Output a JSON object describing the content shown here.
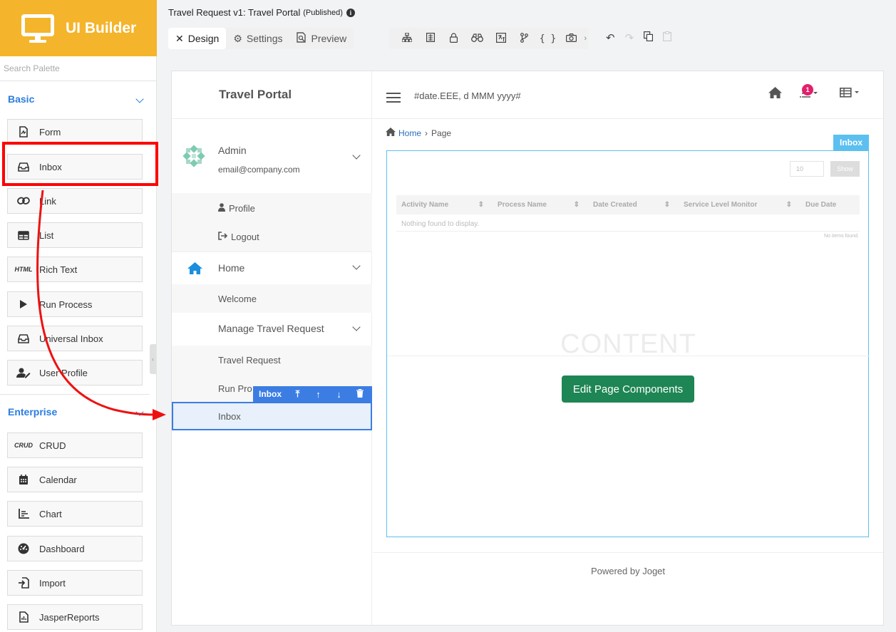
{
  "app": {
    "title": "UI Builder"
  },
  "palette": {
    "search_placeholder": "Search Palette",
    "sections": [
      {
        "title": "Basic",
        "items": [
          {
            "label": "Form",
            "icon": "form-icon"
          },
          {
            "label": "Inbox",
            "icon": "inbox-icon"
          },
          {
            "label": "Link",
            "icon": "link-icon"
          },
          {
            "label": "List",
            "icon": "list-icon"
          },
          {
            "label": "Rich Text",
            "icon": "HTML"
          },
          {
            "label": "Run Process",
            "icon": "play-icon"
          },
          {
            "label": "Universal Inbox",
            "icon": "inbox-icon"
          },
          {
            "label": "User Profile",
            "icon": "user-edit-icon"
          }
        ]
      },
      {
        "title": "Enterprise",
        "items": [
          {
            "label": "CRUD",
            "icon": "CRUD"
          },
          {
            "label": "Calendar",
            "icon": "calendar-icon"
          },
          {
            "label": "Chart",
            "icon": "chart-icon"
          },
          {
            "label": "Dashboard",
            "icon": "dashboard-icon"
          },
          {
            "label": "Import",
            "icon": "import-icon"
          },
          {
            "label": "JasperReports",
            "icon": "report-icon"
          }
        ]
      }
    ]
  },
  "header": {
    "doc_title": "Travel Request v1: Travel Portal",
    "status": "(Published)",
    "tabs": [
      {
        "label": "Design",
        "icon": "design-icon",
        "active": true
      },
      {
        "label": "Settings",
        "icon": "gear-icon",
        "active": false
      },
      {
        "label": "Preview",
        "icon": "preview-icon",
        "active": false
      }
    ]
  },
  "canvas": {
    "portal_title": "Travel Portal",
    "user": {
      "name": "Admin",
      "email": "email@company.com"
    },
    "user_menu": [
      "Profile",
      "Logout"
    ],
    "menu": {
      "home": "Home",
      "home_items": [
        "Welcome"
      ],
      "manage": "Manage Travel Request",
      "manage_items": [
        "Travel Request",
        "Run Pro"
      ],
      "selected_item": "Inbox"
    },
    "element_toolbar": {
      "label": "Inbox"
    },
    "topbar": {
      "date_format": "#date.EEE, d MMM yyyy#",
      "notification_count": "1"
    },
    "breadcrumb": {
      "home": "Home",
      "page": "Page"
    },
    "content_label": "Inbox",
    "inbox_table": {
      "page_size": "10",
      "show_button": "Show",
      "columns": [
        "Activity Name",
        "Process Name",
        "Date Created",
        "Service Level Monitor",
        "Due Date"
      ],
      "empty_text": "Nothing found to display.",
      "no_items": "No items found."
    },
    "watermark": "CONTENT",
    "edit_button": "Edit Page Components",
    "footer": "Powered by Joget"
  },
  "colors": {
    "brand": "#f4b42b",
    "accent": "#2a7de1",
    "selection": "#3b7de3",
    "edit_button": "#1e8654",
    "annotation": "#ff0000"
  }
}
